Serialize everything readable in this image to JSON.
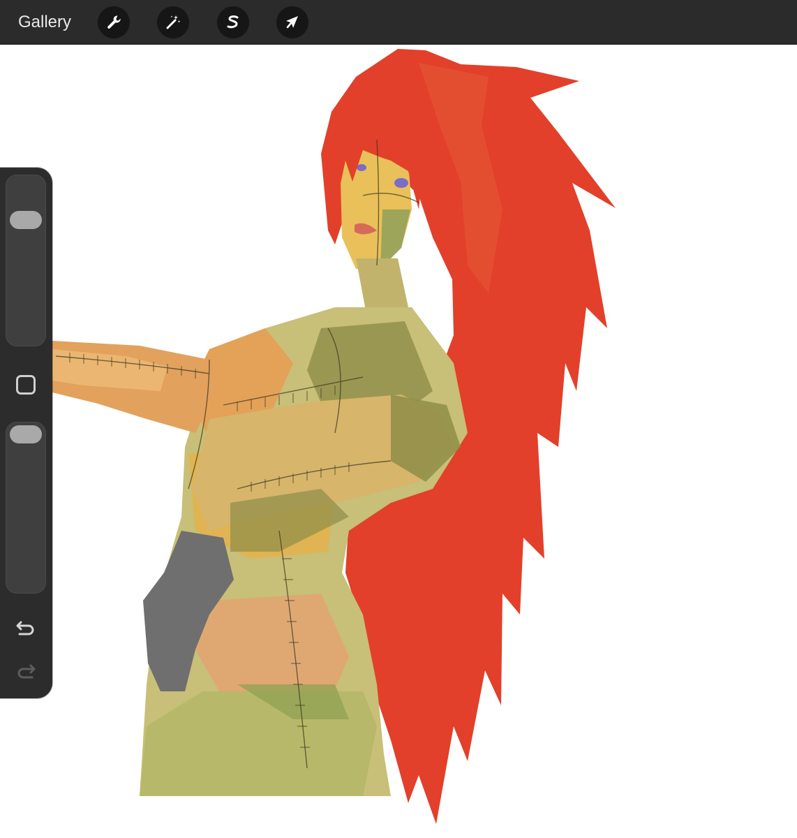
{
  "toolbar": {
    "gallery_label": "Gallery",
    "tools": [
      {
        "name": "actions",
        "icon": "wrench-icon"
      },
      {
        "name": "adjustments",
        "icon": "magic-wand-icon"
      },
      {
        "name": "selection",
        "icon": "selection-s-icon"
      },
      {
        "name": "transform",
        "icon": "arrow-cursor-icon"
      }
    ]
  },
  "sidebar": {
    "brush_size_level": 0.72,
    "brush_opacity_level": 0.9,
    "modify_icon": "square-icon",
    "undo_icon": "undo-icon",
    "redo_icon": "redo-icon",
    "redo_enabled": false
  },
  "colors": {
    "toolbar_bg": "#2b2b2b",
    "sidebar_bg": "#2c2c2c",
    "hair": "#e2402a",
    "skin_green": "#b8b86a",
    "skin_orange": "#e7a45a",
    "glove": "#6f6f6f"
  }
}
